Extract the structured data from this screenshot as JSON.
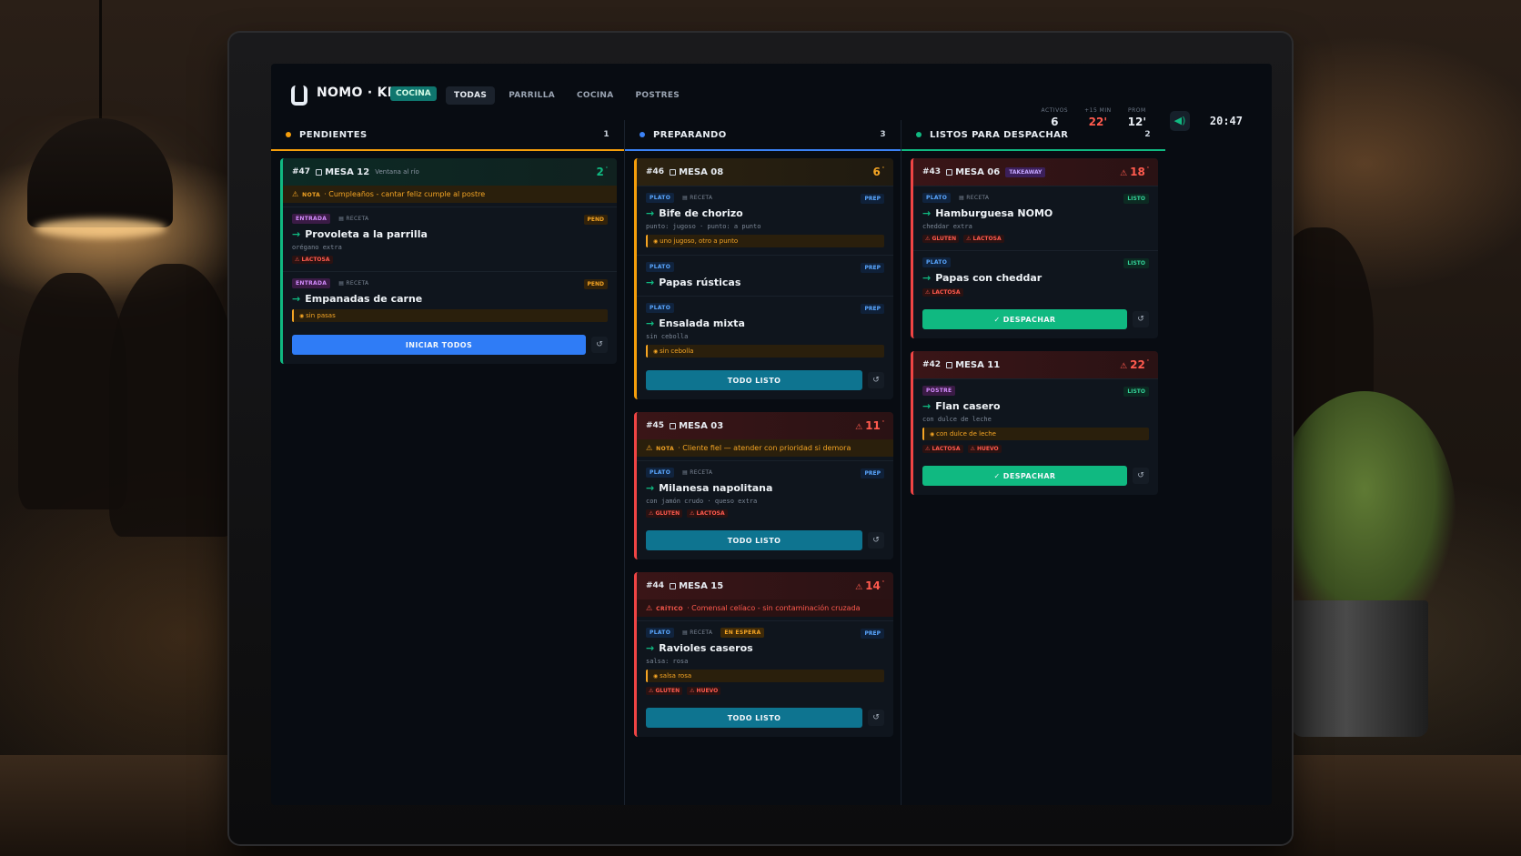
{
  "app": {
    "brand": "NOMO · KDS",
    "station_badge": "COCINA"
  },
  "tabs": [
    "TODAS",
    "PARRILLA",
    "COCINA",
    "POSTRES"
  ],
  "stats": [
    {
      "label": "ACTIVOS",
      "value": "6"
    },
    {
      "label": "+15 MIN",
      "value": "22'"
    },
    {
      "label": "PROM",
      "value": "12'"
    }
  ],
  "clock": "20:47",
  "icons": {
    "sound": "speaker-icon",
    "undo": "undo-icon",
    "note": "warning-icon",
    "table": "table-icon"
  },
  "colors": {
    "pending": "#f59e0b",
    "preparing": "#3b82f6",
    "ready": "#10b981",
    "danger": "#ef4444"
  },
  "columns": [
    {
      "title": "PENDIENTES",
      "count": "1",
      "tickets": [
        {
          "number": "#47",
          "table": "MESA 12",
          "subtitle": "Ventana al río",
          "subtitle_badge": false,
          "timer": "2",
          "timer_warn": false,
          "note": {
            "label": "NOTA",
            "text": "Cumpleaños - cantar feliz cumple al postre"
          },
          "items": [
            {
              "category": "ENTRADA",
              "recipe": "RECETA",
              "state": "PEND",
              "name": "Provoleta a la parrilla",
              "mods": "orégano extra",
              "allergens": [
                "LACTOSA"
              ]
            },
            {
              "category": "ENTRADA",
              "recipe": "RECETA",
              "state": "PEND",
              "name": "Empanadas de carne",
              "item_note": "sin pasas"
            }
          ],
          "action": "INICIAR TODOS"
        }
      ]
    },
    {
      "title": "PREPARANDO",
      "count": "3",
      "tickets": [
        {
          "number": "#46",
          "table": "MESA 08",
          "timer": "6",
          "timer_warn": false,
          "items": [
            {
              "category": "PLATO",
              "recipe": "RECETA",
              "state": "PREP",
              "name": "Bife de chorizo",
              "mods": "punto: jugoso · punto: a punto",
              "item_note": "uno jugoso, otro a punto"
            },
            {
              "category": "PLATO",
              "state": "PREP",
              "name": "Papas rústicas"
            },
            {
              "category": "PLATO",
              "state": "PREP",
              "name": "Ensalada mixta",
              "mods": "sin cebolla",
              "item_note": "sin cebolla"
            }
          ],
          "action": "TODO LISTO"
        },
        {
          "number": "#45",
          "table": "MESA 03",
          "timer": "11",
          "timer_warn": true,
          "note": {
            "label": "NOTA",
            "text": "Cliente fiel — atender con prioridad si demora"
          },
          "items": [
            {
              "category": "PLATO",
              "recipe": "RECETA",
              "state": "PREP",
              "name": "Milanesa napolitana",
              "mods": "con jamón crudo · queso extra",
              "allergens": [
                "GLUTEN",
                "LACTOSA"
              ]
            }
          ],
          "action": "TODO LISTO"
        },
        {
          "number": "#44",
          "table": "MESA 15",
          "timer": "14",
          "timer_warn": true,
          "note": {
            "label": "CRÍTICO",
            "text": "Comensal celíaco - sin contaminación cruzada"
          },
          "items": [
            {
              "category": "PLATO",
              "recipe": "RECETA",
              "wait": "EN ESPERA",
              "state": "PREP",
              "name": "Ravioles caseros",
              "mods": "salsa: rosa",
              "item_note": "salsa rosa",
              "allergens": [
                "GLUTEN",
                "HUEVO"
              ]
            }
          ],
          "action": "TODO LISTO"
        }
      ]
    },
    {
      "title": "LISTOS PARA DESPACHAR",
      "count": "2",
      "tickets": [
        {
          "number": "#43",
          "table": "MESA 06",
          "subtitle": "TAKEAWAY",
          "subtitle_badge": true,
          "timer": "18",
          "timer_warn": true,
          "items": [
            {
              "category": "PLATO",
              "recipe": "RECETA",
              "state": "LISTO",
              "name": "Hamburguesa NOMO",
              "mods": "cheddar extra",
              "allergens": [
                "GLUTEN",
                "LACTOSA"
              ]
            },
            {
              "category": "PLATO",
              "state": "LISTO",
              "name": "Papas con cheddar",
              "allergens": [
                "LACTOSA"
              ]
            }
          ],
          "action": "✓ DESPACHAR"
        },
        {
          "number": "#42",
          "table": "MESA 11",
          "timer": "22",
          "timer_warn": true,
          "items": [
            {
              "category": "POSTRE",
              "state": "LISTO",
              "name": "Flan casero",
              "mods": "con dulce de leche",
              "item_note": "con dulce de leche",
              "allergens": [
                "LACTOSA",
                "HUEVO"
              ]
            }
          ],
          "action": "✓ DESPACHAR"
        }
      ]
    }
  ]
}
